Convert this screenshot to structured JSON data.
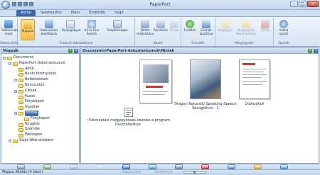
{
  "window": {
    "title": "PaperPort"
  },
  "tabs": [
    {
      "label": "Asztal",
      "active": true
    },
    {
      "label": "Szerkesztés",
      "active": false
    },
    {
      "label": "Elem",
      "active": false
    },
    {
      "label": "Eszközök",
      "active": false
    },
    {
      "label": "Súgó",
      "active": false
    }
  ],
  "ribbon": {
    "groups": [
      {
        "label": "Szkennelés"
      },
      {
        "label": "Funkció-áttekintések"
      },
      {
        "label": "Nézet"
      },
      {
        "label": "Frissítés"
      },
      {
        "label": "Megjegyzés"
      },
      {
        "label": "Opciók"
      }
    ],
    "buttons": {
      "scan_now": "Szkennelés most",
      "folders": "Mappák",
      "scan_settings": "Szkennelési beállítások",
      "page_thumbnails": "Bélyegképek",
      "all_in_one_search": "All-in-One Search",
      "properties": "Tulajdonságok",
      "view_mode": "Nézet módosítása",
      "arrange": "Rendezés",
      "back": "Vissza",
      "refresh": "Frissítés",
      "align_items": "Elemek igazítása",
      "notes": "Megjegyz.",
      "note_from_desk": "Megjegyzés kép mezőben",
      "delete": "Törlés",
      "desktop_options": "Asztal opciói"
    }
  },
  "sidebar": {
    "title": "Mappák",
    "tree": [
      {
        "label": "Documents",
        "expander": "−",
        "level": 0
      },
      {
        "label": "PaperPort-dokumentumok",
        "expander": "−",
        "level": 1
      },
      {
        "label": "Adók",
        "expander": "",
        "level": 2
      },
      {
        "label": "Banki bizonylatok",
        "expander": "",
        "level": 2
      },
      {
        "label": "Befektetések",
        "expander": "+",
        "level": 2
      },
      {
        "label": "Bemutatók",
        "expander": "",
        "level": 2
      },
      {
        "label": "Cikkek",
        "expander": "+",
        "level": 2
      },
      {
        "label": "Faxok",
        "expander": "",
        "level": 2
      },
      {
        "label": "Fényképek",
        "expander": "",
        "level": 2
      },
      {
        "label": "Ingatlan",
        "expander": "",
        "level": 2
      },
      {
        "label": "Minták",
        "expander": "−",
        "level": 2,
        "selected": true
      },
      {
        "label": "Fényképek",
        "expander": "",
        "level": 3
      },
      {
        "label": "Nyugtok",
        "expander": "",
        "level": 2
      },
      {
        "label": "Számlák",
        "expander": "",
        "level": 2
      },
      {
        "label": "Weblapok",
        "expander": "",
        "level": 2
      },
      {
        "label": "Saját Web-oldalaim",
        "expander": "+",
        "level": 1
      }
    ]
  },
  "main": {
    "path": "Documents\\PaperPort-dokumentumok\\Minták",
    "items": [
      {
        "label": "~Kibocsátási megjegyzések-kezelés a program használatához"
      },
      {
        "label": "Dragon Naturally Speaking Speech Recognition - 1"
      },
      {
        "label": "Üdvözöljük"
      }
    ]
  },
  "bottom_icons": [
    "printer-icon",
    "wand-icon",
    "pages-icon",
    "page-icon",
    "word-icon",
    "globe-icon",
    "ftp-icon",
    "pdf-icon",
    "email-icon",
    "shield-icon",
    "circle-icon"
  ],
  "status": {
    "text": "Mappa: Minták (4 elem).",
    "page_label": "Előző oldal",
    "next_label": "Következő"
  },
  "colors": {
    "accent": "#3a68a8",
    "folder": "#f2c44a",
    "selection": "#3c6fb4"
  }
}
